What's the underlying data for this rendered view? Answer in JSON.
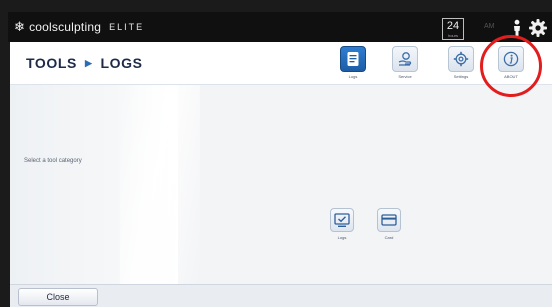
{
  "app": {
    "brand": "coolsculpting",
    "edition": "ELITE"
  },
  "status": {
    "hours": "24",
    "hours_caption": "hours",
    "faint_text": "AM"
  },
  "breadcrumb": {
    "section": "TOOLS",
    "page": "LOGS"
  },
  "tools": [
    {
      "label": "Logs",
      "icon": "document-icon"
    },
    {
      "label": "Service",
      "icon": "service-hand-icon"
    },
    {
      "label": "Settings",
      "icon": "gear-icon"
    },
    {
      "label": "ABOUT",
      "icon": "info-icon"
    }
  ],
  "main": {
    "prompt": "Select a tool category",
    "categories": [
      {
        "label": "Logs",
        "icon": "monitor-check-icon"
      },
      {
        "label": "Card",
        "icon": "card-icon"
      }
    ]
  },
  "footer": {
    "close_label": "Close"
  },
  "colors": {
    "accent": "#2a6db7",
    "title": "#1d2b48",
    "highlight_circle": "#e21d1d"
  }
}
